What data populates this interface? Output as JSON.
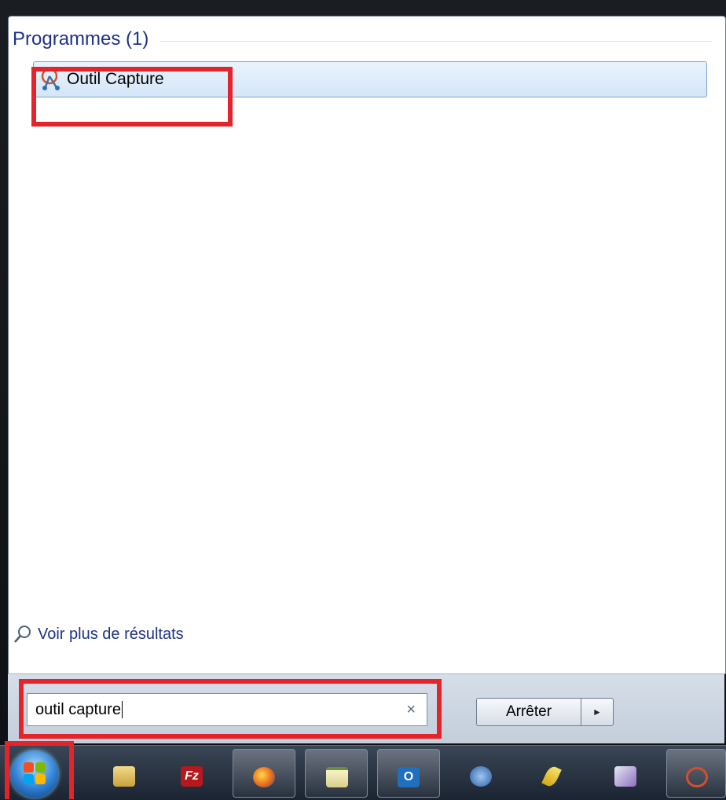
{
  "results_panel": {
    "section_title": "Programmes (1)",
    "item_label": "Outil Capture",
    "see_more_label": "Voir plus de résultats"
  },
  "search": {
    "value": "outil capture",
    "clear_symbol": "×"
  },
  "shutdown": {
    "label": "Arrêter",
    "arrow_symbol": "►"
  },
  "taskbar": {
    "pinned": [
      {
        "name": "file-explorer"
      },
      {
        "name": "filezilla",
        "label": "Fz"
      },
      {
        "name": "firefox"
      },
      {
        "name": "notepad"
      },
      {
        "name": "outlook",
        "label": "O"
      },
      {
        "name": "security-app"
      },
      {
        "name": "feather-app"
      },
      {
        "name": "paint-app"
      },
      {
        "name": "snipping-tool"
      }
    ]
  },
  "colors": {
    "accent_text": "#1e3287",
    "highlight": "#e3252b",
    "selection": "#d4e6f8"
  }
}
